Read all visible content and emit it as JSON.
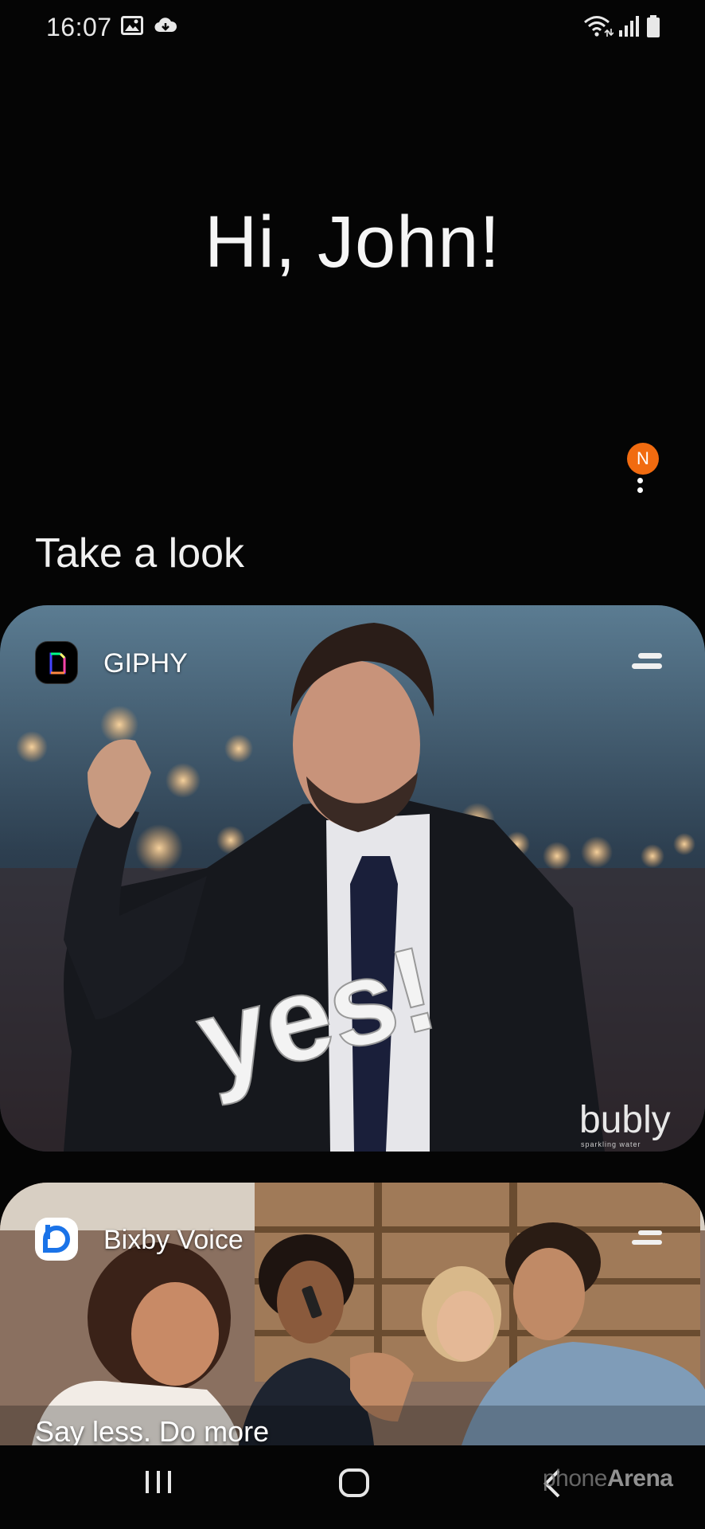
{
  "status_bar": {
    "time": "16:07"
  },
  "greeting": "Hi, John!",
  "notification_badge": "N",
  "section_title": "Take a look",
  "cards": [
    {
      "app_name": "GIPHY",
      "image_text": "yes!",
      "watermark": "bubly",
      "watermark_sub": "sparkling water"
    },
    {
      "app_name": "Bixby Voice",
      "tagline": "Say less. Do more"
    }
  ],
  "watermark": {
    "brand": "phone",
    "brand_strong": "Arena"
  },
  "colors": {
    "background": "#050505",
    "badge": "#f16b10",
    "bixby_blue": "#1a73e8"
  }
}
